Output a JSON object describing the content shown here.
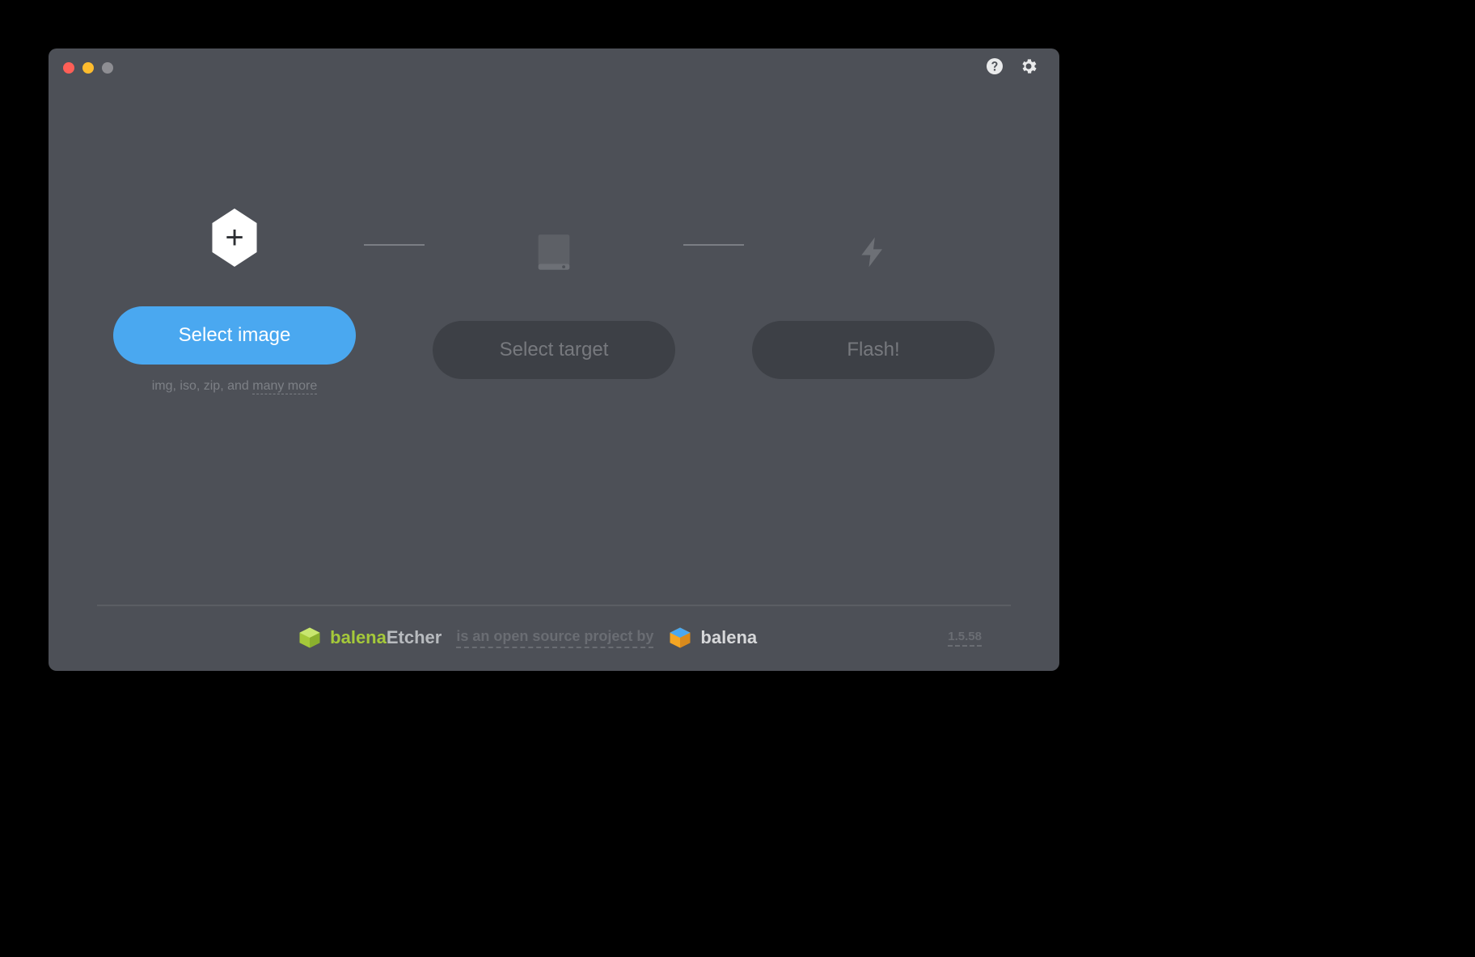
{
  "steps": {
    "select_image": {
      "label": "Select image",
      "hint_prefix": "img, iso, zip, and ",
      "hint_link": "many more"
    },
    "select_target": {
      "label": "Select target"
    },
    "flash": {
      "label": "Flash!"
    }
  },
  "footer": {
    "brand_balena": "balena",
    "brand_etcher": "Etcher",
    "tagline": "is an open source project by",
    "brand_company": "balena",
    "version": "1.5.58"
  }
}
